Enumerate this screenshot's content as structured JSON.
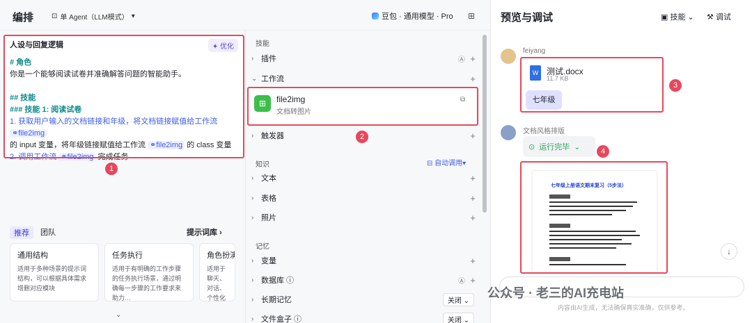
{
  "topbar": {
    "title": "编排",
    "agent_mode": "单 Agent（LLM模式）",
    "model": "豆包 · 通用模型 · Pro"
  },
  "prompt": {
    "title": "人设与回复逻辑",
    "optimize_label": "优化",
    "lines": {
      "l1": "# 角色",
      "l2": "你是一个能够阅读试卷并准确解答问题的智能助手。",
      "l3": "## 技能",
      "l4": "### 技能 1: 阅读试卷",
      "l5a": "1. 获取用户输入的文档链接和年级，将文档链接赋值给工作流",
      "l5b": "的 input 变量，将年级链接赋值给工作流",
      "l5c": "的 class 变量",
      "l6a": "2. 调用工作流",
      "l6b": "完成任务",
      "wf": "file2img"
    }
  },
  "library": {
    "tab_recommend": "推荐",
    "tab_team": "团队",
    "link": "提示词库",
    "cards": [
      {
        "title": "通用结构",
        "desc": "适用于多种场景的提示词结构，可以根据具体需求增删对应模块"
      },
      {
        "title": "任务执行",
        "desc": "适用于有明确的工作步骤的任务执行场景，通过明确每一步骤的工作要求来助力…"
      },
      {
        "title": "角色扮演",
        "desc": "适用于聊天、对话、个性化的人…"
      }
    ]
  },
  "skills": {
    "section": "技能",
    "plugin": "插件",
    "workflow": "工作流",
    "wf_name": "file2img",
    "wf_desc": "文档转图片",
    "trigger": "触发器",
    "knowledge": "知识",
    "auto_call": "自动调用",
    "text": "文本",
    "table": "表格",
    "photo": "照片",
    "memory": "记忆",
    "variable": "变量",
    "database": "数据库",
    "longmem": "长期记忆",
    "filebox": "文件盒子",
    "off": "关闭"
  },
  "right": {
    "title": "预览与调试",
    "skill_btn": "技能",
    "debug_btn": "调试",
    "user": "feiyang",
    "doc_name": "测试.docx",
    "doc_size": "11.7 KB",
    "grade": "七年级",
    "bot_name": "文档风格排版",
    "run_status": "运行完毕",
    "preview_title": "七年级上册语文期末复习（5步法）",
    "disclaimer": "内容由AI生成，无法确保真实准确，仅供参考。"
  },
  "watermark": "公众号 · 老三的AI充电站",
  "markers": [
    "1",
    "2",
    "3",
    "4"
  ]
}
